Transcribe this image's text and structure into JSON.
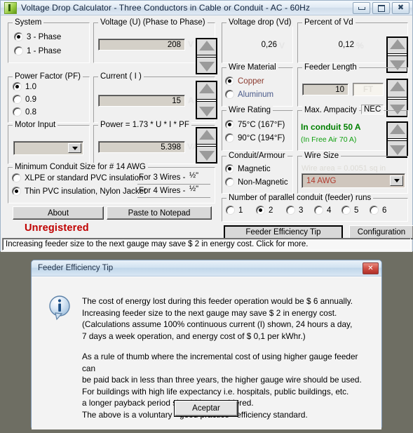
{
  "window": {
    "title": "Voltage Drop Calculator - Three Conductors in Cable or Conduit  - AC - 60Hz",
    "icon": "app-icon",
    "buttons": {
      "minimize": "minimize",
      "maximize": "maximize",
      "close": "close"
    }
  },
  "left": {
    "system": {
      "title": "System",
      "options": [
        {
          "label": "3 - Phase",
          "selected": true
        },
        {
          "label": "1 - Phase",
          "selected": false
        }
      ]
    },
    "voltage": {
      "title": "Voltage (U) (Phase to Phase)",
      "value": "208",
      "unit": "V"
    },
    "power_factor": {
      "title": "Power Factor (PF)",
      "options": [
        {
          "label": "1.0",
          "selected": true
        },
        {
          "label": "0.9",
          "selected": false
        },
        {
          "label": "0.8",
          "selected": false
        }
      ]
    },
    "current": {
      "title": "Current ( I )",
      "value": "15",
      "unit": "A"
    },
    "motor_input": {
      "title": "Motor Input",
      "value": ""
    },
    "power": {
      "title": "Power = 1.73 * U * I * PF",
      "value": "5.398",
      "unit": "VA"
    },
    "conduit_size": {
      "title": "Minimum Conduit Size for #  14 AWG",
      "options": [
        {
          "label": "XLPE  or standard PVC insulation",
          "selected": false
        },
        {
          "label": "Thin PVC insulation, Nylon Jacket",
          "selected": true
        }
      ],
      "rows": [
        {
          "label": "For 3 Wires -",
          "value": "½\""
        },
        {
          "label": "For 4 Wires -",
          "value": "½\""
        }
      ]
    },
    "about_button": "About",
    "paste_button": "Paste to Notepad",
    "unregistered": "Unregistered"
  },
  "right": {
    "voltage_drop": {
      "title": "Voltage drop (Vd)",
      "value": "0,26",
      "unit": "V"
    },
    "percent_vd": {
      "title": "Percent of Vd",
      "value": "0,12",
      "unit": "%"
    },
    "wire_material": {
      "title": "Wire Material",
      "options": [
        {
          "label": "Copper",
          "selected": true
        },
        {
          "label": "Aluminum",
          "selected": false
        }
      ]
    },
    "feeder_length": {
      "title": "Feeder Length",
      "value": "10",
      "unit": "FT"
    },
    "wire_rating": {
      "title": "Wire Rating",
      "options": [
        {
          "label": "75°C (167°F)",
          "selected": true
        },
        {
          "label": "90°C (194°F)",
          "selected": false
        }
      ]
    },
    "ampacity": {
      "title": "Max. Ampacity",
      "tag": "NEC",
      "in_conduit": "In conduit 50 A",
      "free_air": "(In Free Air 70 A)"
    },
    "conduit_armour": {
      "title": "Conduit/Armour",
      "options": [
        {
          "label": "Magnetic",
          "selected": true
        },
        {
          "label": "Non-Magnetic",
          "selected": false
        }
      ]
    },
    "wire_size": {
      "title": "Wire Size",
      "watermark": "Wire area = 0.0051 sq in",
      "value": "14 AWG"
    },
    "parallel_runs": {
      "title": "Number of parallel conduit (feeder) runs",
      "options": [
        {
          "label": "1",
          "selected": false
        },
        {
          "label": "2",
          "selected": true
        },
        {
          "label": "3",
          "selected": false
        },
        {
          "label": "4",
          "selected": false
        },
        {
          "label": "5",
          "selected": false
        },
        {
          "label": "6",
          "selected": false
        }
      ]
    },
    "feeder_tip_button": "Feeder Efficiency Tip",
    "configuration_button": "Configuration"
  },
  "statusbar": {
    "text": "Increasing feeder size to the next gauge may save $ 2 in energy cost. Click for more."
  },
  "dialog": {
    "title": "Feeder Efficiency Tip",
    "icon": "info-icon",
    "close_label": "✕",
    "paragraph1": [
      "The cost of energy lost during this feeder operation would be $ 6 annually.",
      "Increasing feeder size to the next gauge may save $ 2 in energy cost.",
      "(Calculations assume 100% continuous current (I) shown, 24 hours a day,",
      "7 days a week operation, and energy cost of $ 0,1 per kWhr.)"
    ],
    "paragraph2": [
      "As a rule of thumb where the incremental cost of using higher gauge feeder can",
      "be paid back in less than three years, the higher gauge wire should be used.",
      "For buildings with high life expectancy i.e. hospitals, public buildings, etc.",
      "a longer payback period should be considered.",
      "The above is a voluntary - good practice - efficiency standard."
    ],
    "ok_button": "Aceptar"
  },
  "colors": {
    "copper": "#8b3a2e",
    "aluminum": "#4a5a8a",
    "ampacity_green": "#008000",
    "unregistered_red": "#c00000",
    "wire_size_red": "#b03a2e"
  }
}
